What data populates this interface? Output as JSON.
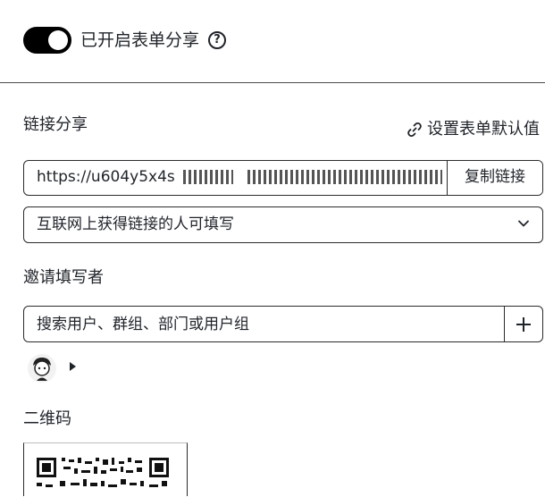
{
  "share": {
    "toggle_on": true,
    "label": "已开启表单分享"
  },
  "link_section": {
    "title": "链接分享",
    "settings_label": "设置表单默认值",
    "url": "https://u604y5x4s",
    "copy_label": "复制链接",
    "permission": "互联网上获得链接的人可填写"
  },
  "invite": {
    "title": "邀请填写者",
    "search_placeholder": "搜索用户、群组、部门或用户组"
  },
  "qr": {
    "title": "二维码"
  }
}
